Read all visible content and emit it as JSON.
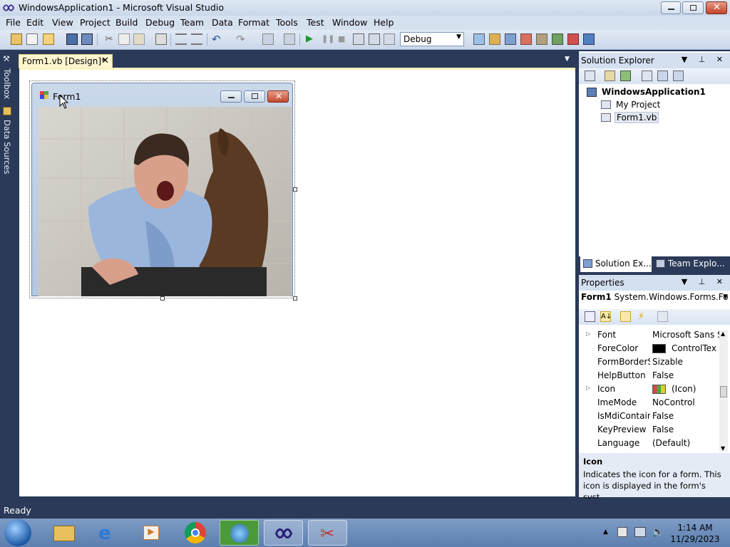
{
  "window": {
    "title": "WindowsApplication1 - Microsoft Visual Studio"
  },
  "menu": [
    "File",
    "Edit",
    "View",
    "Project",
    "Build",
    "Debug",
    "Team",
    "Data",
    "Format",
    "Tools",
    "Test",
    "Window",
    "Help"
  ],
  "toolbar": {
    "configuration": "Debug"
  },
  "side": {
    "toolbox": "Toolbox",
    "data_sources": "Data Sources"
  },
  "document_tab": {
    "label": "Form1.vb [Design]*"
  },
  "form": {
    "title": "Form1"
  },
  "solution_explorer": {
    "title": "Solution Explorer",
    "solution": "WindowsApplication1",
    "items": [
      "My Project",
      "Form1.vb"
    ],
    "tabs": [
      "Solution Ex...",
      "Team Explo..."
    ]
  },
  "properties": {
    "title": "Properties",
    "object_name": "Form1",
    "object_type": "System.Windows.Forms.Fo",
    "rows": [
      {
        "name": "Font",
        "value": "Microsoft Sans S"
      },
      {
        "name": "ForeColor",
        "value": "ControlTex"
      },
      {
        "name": "FormBorderSt",
        "value": "Sizable"
      },
      {
        "name": "HelpButton",
        "value": "False"
      },
      {
        "name": "Icon",
        "value": "(Icon)"
      },
      {
        "name": "ImeMode",
        "value": "NoControl"
      },
      {
        "name": "IsMdiContain",
        "value": "False"
      },
      {
        "name": "KeyPreview",
        "value": "False"
      },
      {
        "name": "Language",
        "value": "(Default)"
      }
    ],
    "description_title": "Icon",
    "description_text": "Indicates the icon for a form. This icon is displayed in the form's syst..."
  },
  "status": {
    "text": "Ready"
  },
  "clock": {
    "time": "1:14 AM",
    "date": "11/29/2023"
  },
  "colors": {
    "chrome": "#2b3a58",
    "tab_active": "#fff5d0",
    "designer_bg": "#ffffff"
  }
}
